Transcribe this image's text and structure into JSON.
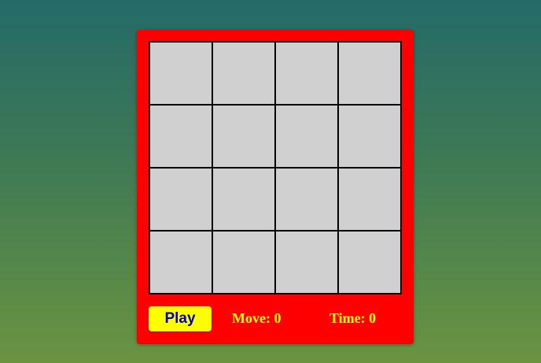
{
  "colors": {
    "panel": "#ff0000",
    "tile": "#d0d0d0",
    "button_bg": "#ffff00",
    "button_text": "#0000cc",
    "stat_text": "#ffff00"
  },
  "board": {
    "rows": 4,
    "cols": 4,
    "tiles": [
      "",
      "",
      "",
      "",
      "",
      "",
      "",
      "",
      "",
      "",
      "",
      "",
      "",
      "",
      "",
      ""
    ]
  },
  "controls": {
    "play_label": "Play"
  },
  "stats": {
    "move_label": "Move: 0",
    "time_label": "Time: 0"
  }
}
